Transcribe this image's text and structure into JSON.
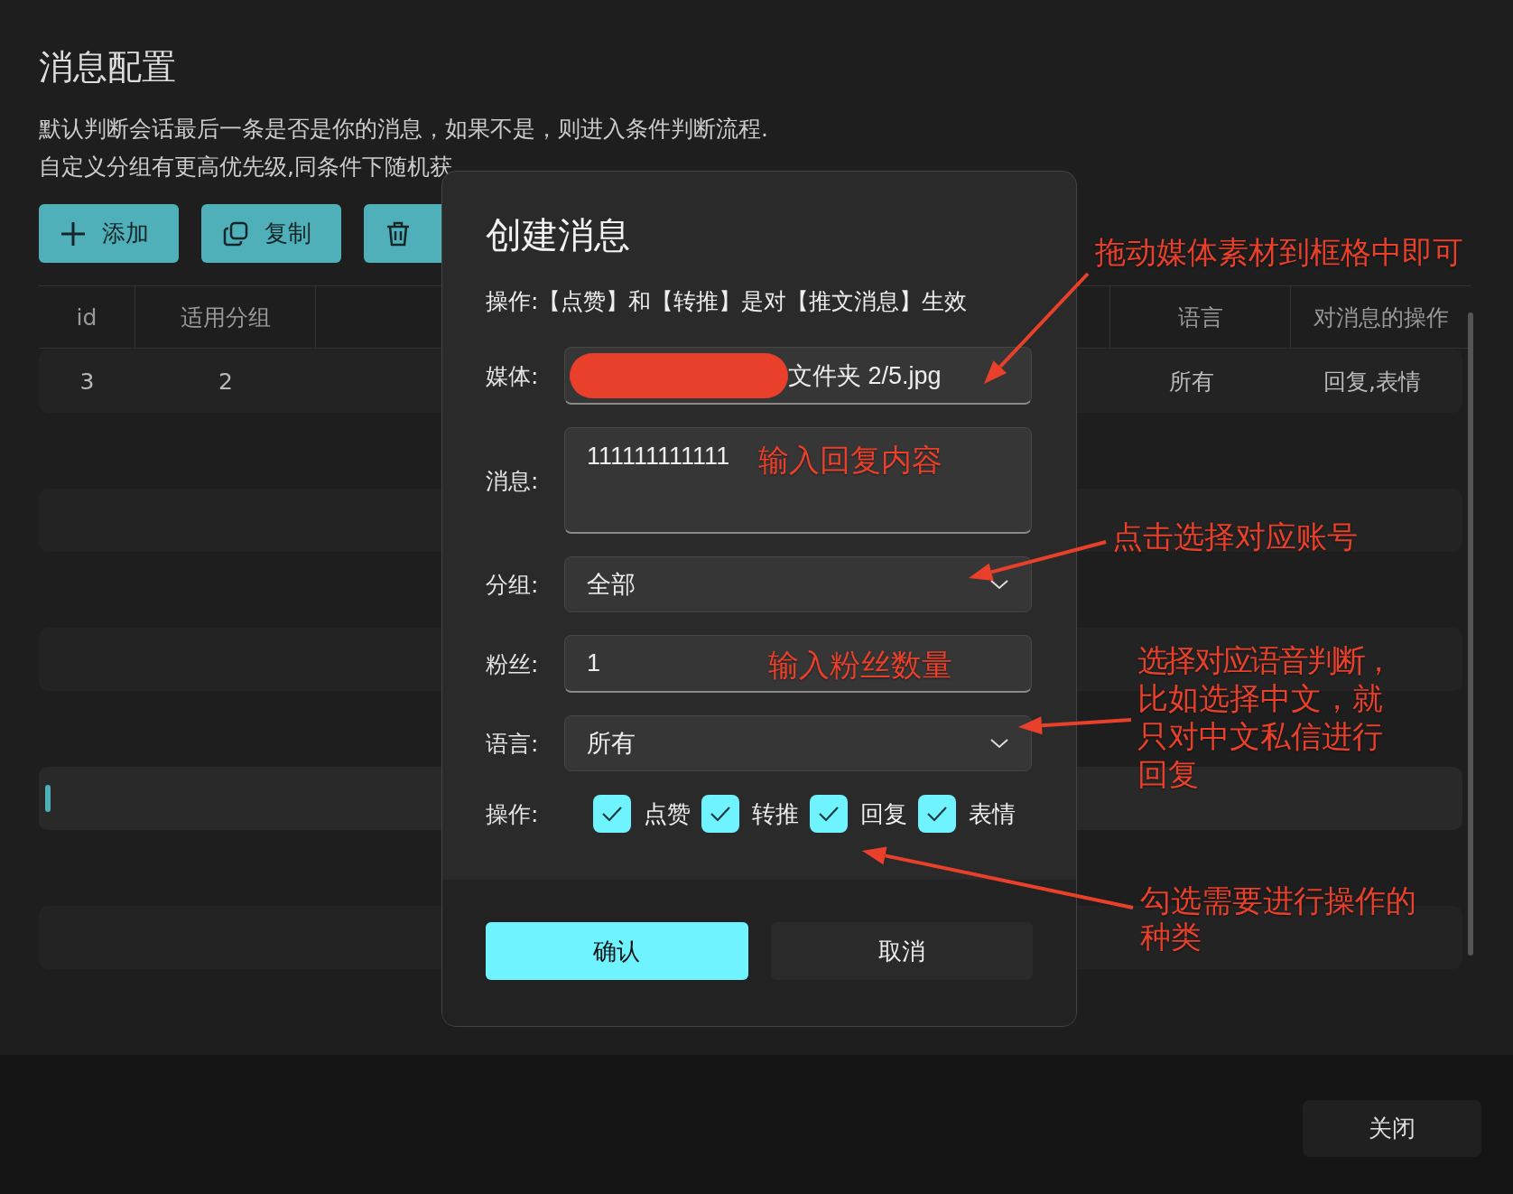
{
  "page": {
    "title": "消息配置",
    "description": [
      "默认判断会话最后一条是否是你的消息，如果不是，则进入条件判断流程.",
      "自定义分组有更高优先级,同条件下随机获"
    ]
  },
  "toolbar": [
    {
      "kind": "add",
      "label": "添加"
    },
    {
      "kind": "copy",
      "label": "复制"
    },
    {
      "kind": "delete"
    }
  ],
  "table": {
    "columns": [
      "id",
      "适用分组",
      "语言",
      "对消息的操作"
    ],
    "rows": [
      {
        "cells": [
          "3",
          "2",
          "所有",
          "回复,表情"
        ],
        "selected": false
      },
      {
        "selected": false
      },
      {
        "selected": false
      },
      {
        "selected": true
      },
      {
        "selected": false
      }
    ]
  },
  "dialog": {
    "title": "创建消息",
    "note": "操作:【点赞】和【转推】是对【推文消息】生效",
    "fields": [
      {
        "kind": "media",
        "label": "媒体:",
        "value": "文件夹 2/5.jpg",
        "redacted": true
      },
      {
        "kind": "textarea",
        "label": "消息:",
        "value": "111111111111"
      },
      {
        "kind": "select",
        "label": "分组:",
        "value": "全部"
      },
      {
        "kind": "input",
        "label": "粉丝:",
        "value": "1"
      },
      {
        "kind": "select",
        "label": "语言:",
        "value": "所有"
      }
    ],
    "actions_label": "操作:",
    "actions": [
      {
        "label": "点赞",
        "checked": true
      },
      {
        "label": "转推",
        "checked": true
      },
      {
        "label": "回复",
        "checked": true
      },
      {
        "label": "表情",
        "checked": true
      }
    ],
    "buttons": [
      {
        "kind": "primary",
        "label": "确认"
      },
      {
        "kind": "secondary",
        "label": "取消"
      }
    ]
  },
  "footer": {
    "close_button": "关闭"
  },
  "annotations": [
    {
      "text": "拖动媒体素材到框格中即可"
    },
    {
      "text": "输入回复内容"
    },
    {
      "text": "点击选择对应账号"
    },
    {
      "text": "输入粉丝数量"
    },
    {
      "text": "选择对应语音判断，比如选择中文，就只对中文私信进行回复"
    },
    {
      "text": "勾选需要进行操作的种类"
    }
  ]
}
